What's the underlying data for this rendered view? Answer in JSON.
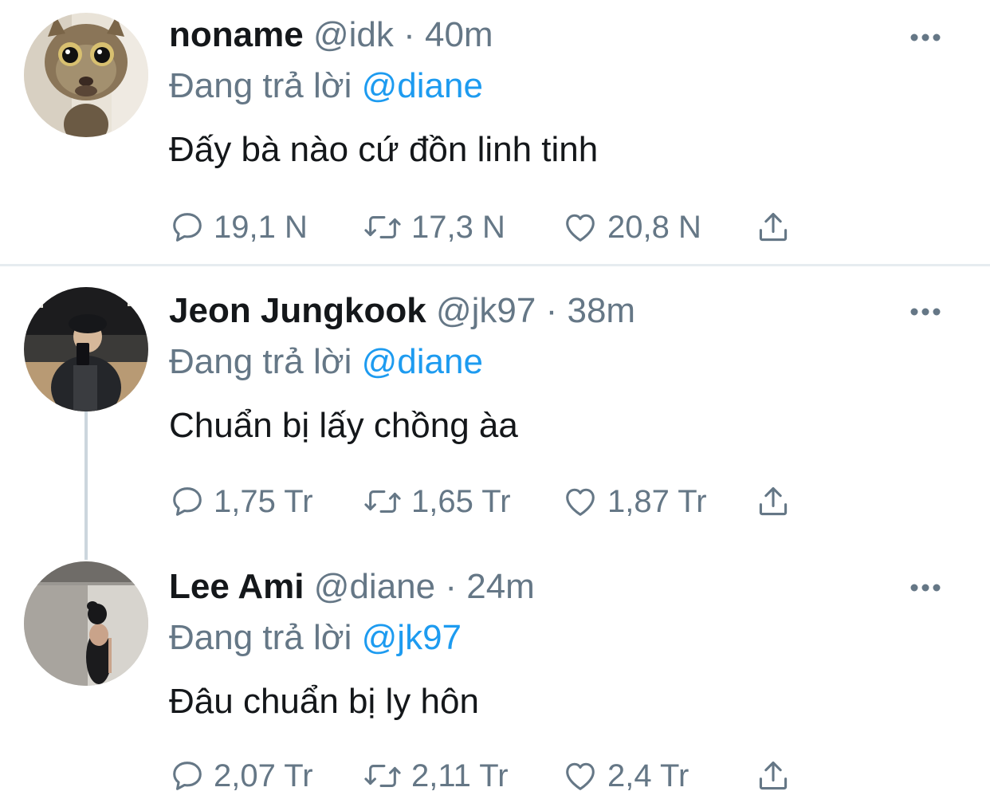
{
  "colors": {
    "text": "#14171a",
    "secondary": "#657786",
    "accent": "#1d9bf0",
    "divider": "#e6ecf0",
    "thread_line": "#ccd6dd"
  },
  "tweets": [
    {
      "name": "noname",
      "handle": "@idk",
      "dot": "·",
      "time": "40m",
      "reply_prefix": "Đang trả lời",
      "reply_to": "@diane",
      "text": "Đấy bà nào cứ đồn linh tinh",
      "replies": "19,1 N",
      "retweets": "17,3 N",
      "likes": "20,8 N",
      "avatar_icon": "cat-avatar"
    },
    {
      "name": "Jeon Jungkook",
      "handle": "@jk97",
      "dot": "·",
      "time": "38m",
      "reply_prefix": "Đang trả lời",
      "reply_to": "@diane",
      "text": "Chuẩn bị lấy chồng àa",
      "replies": "1,75 Tr",
      "retweets": "1,65 Tr",
      "likes": "1,87 Tr",
      "avatar_icon": "person-mirror-selfie-avatar"
    },
    {
      "name": "Lee Ami",
      "handle": "@diane",
      "dot": "·",
      "time": "24m",
      "reply_prefix": "Đang trả lời",
      "reply_to": "@jk97",
      "text": "Đâu chuẩn bị ly hôn",
      "replies": "2,07 Tr",
      "retweets": "2,11 Tr",
      "likes": "2,4 Tr",
      "avatar_icon": "woman-back-avatar"
    }
  ],
  "icons": {
    "reply": "reply-icon",
    "retweet": "retweet-icon",
    "like": "heart-icon",
    "share": "share-icon",
    "more": "more-options-icon"
  }
}
